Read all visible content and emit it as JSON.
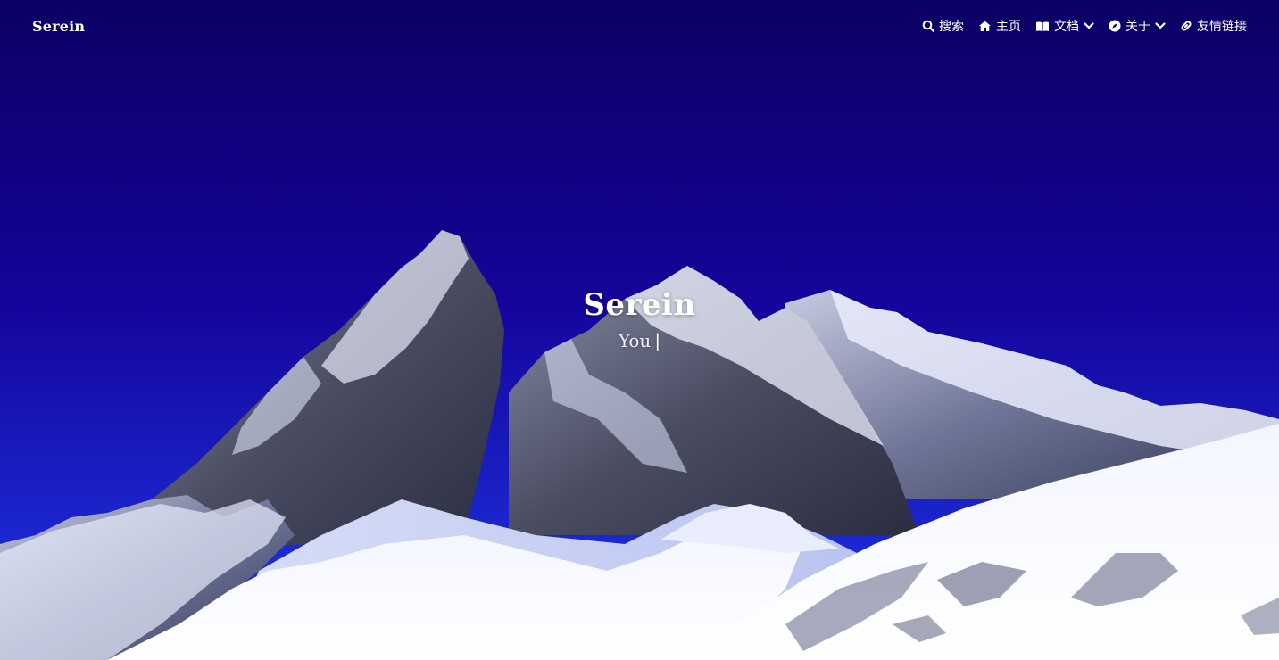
{
  "brand": {
    "name": "Serein"
  },
  "nav": {
    "items": [
      {
        "label": "搜索",
        "icon": "search-icon",
        "dropdown": false
      },
      {
        "label": "主页",
        "icon": "home-icon",
        "dropdown": false
      },
      {
        "label": "文档",
        "icon": "book-icon",
        "dropdown": true
      },
      {
        "label": "关于",
        "icon": "compass-icon",
        "dropdown": true
      },
      {
        "label": "友情链接",
        "icon": "link-icon",
        "dropdown": false
      }
    ]
  },
  "hero": {
    "title": "Serein",
    "subtitle": "You",
    "cursor": "|",
    "background_icon": "snow-mountain-image",
    "scroll_icon": "chevron-down-icon"
  },
  "colors": {
    "sky_top": "#0c0064",
    "sky_bottom": "#1a2ad0",
    "text": "#ffffff"
  }
}
